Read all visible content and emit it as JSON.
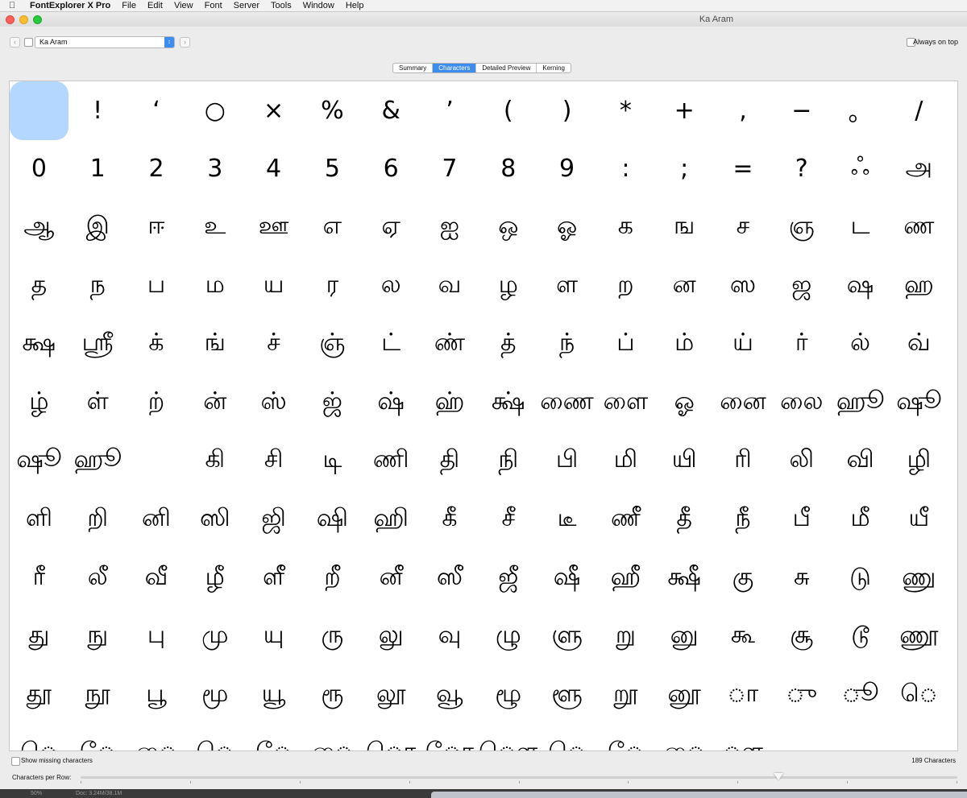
{
  "menubar": {
    "app_name": "FontExplorer X Pro",
    "items": [
      "File",
      "Edit",
      "View",
      "Font",
      "Server",
      "Tools",
      "Window",
      "Help"
    ]
  },
  "window": {
    "title": "Ka Aram"
  },
  "toolbar": {
    "font_select_value": "Ka Aram",
    "always_on_top_label": "Always on top"
  },
  "tabs": [
    {
      "label": "Summary",
      "active": false
    },
    {
      "label": "Characters",
      "active": true
    },
    {
      "label": "Detailed Preview",
      "active": false
    },
    {
      "label": "Kerning",
      "active": false
    }
  ],
  "glyphs": [
    "",
    "!",
    "‘",
    "○",
    "×",
    "%",
    "&",
    "’",
    "(",
    ")",
    "*",
    "+",
    ",",
    "−",
    "。",
    "/",
    "0",
    "1",
    "2",
    "3",
    "4",
    "5",
    "6",
    "7",
    "8",
    "9",
    ":",
    ";",
    "=",
    "?",
    "ஃ",
    "அ",
    "ஆ",
    "இ",
    "ஈ",
    "உ",
    "ஊ",
    "எ",
    "ஏ",
    "ஐ",
    "ஒ",
    "ஓ",
    "க",
    "ங",
    "ச",
    "ஞ",
    "ட",
    "ண",
    "த",
    "ந",
    "ப",
    "ம",
    "ய",
    "ர",
    "ல",
    "வ",
    "ழ",
    "ள",
    "ற",
    "ன",
    "ஸ",
    "ஜ",
    "ஷ",
    "ஹ",
    "க்ஷ",
    "ஸ்ரீ",
    "க்",
    "ங்",
    "ச்",
    "ஞ்",
    "ட்",
    "ண்",
    "த்",
    "ந்",
    "ப்",
    "ம்",
    "ய்",
    "ர்",
    "ல்",
    "வ்",
    "ழ்",
    "ள்",
    "ற்",
    "ன்",
    "ஸ்",
    "ஜ்",
    "ஷ்",
    "ஹ்",
    "க்ஷ்",
    "ணை",
    "ளை",
    "ஓ",
    "னை",
    "லை",
    "ஹூ",
    "ஷூ",
    "ஷூ",
    "ஹூ",
    "",
    "கி",
    "சி",
    "டி",
    "ணி",
    "தி",
    "நி",
    "பி",
    "மி",
    "யி",
    "ரி",
    "லி",
    "வி",
    "ழி",
    "ளி",
    "றி",
    "னி",
    "ஸி",
    "ஜி",
    "ஷி",
    "ஹி",
    "கீ",
    "சீ",
    "டீ",
    "ணீ",
    "தீ",
    "நீ",
    "பீ",
    "மீ",
    "யீ",
    "ரீ",
    "லீ",
    "வீ",
    "ழீ",
    "ளீ",
    "றீ",
    "னீ",
    "ஸீ",
    "ஜீ",
    "ஷீ",
    "ஹீ",
    "க்ஷீ",
    "கு",
    "சு",
    "டு",
    "ணு",
    "து",
    "நு",
    "பு",
    "மு",
    "யு",
    "ரு",
    "லு",
    "வு",
    "ழு",
    "ளு",
    "று",
    "னு",
    "கூ",
    "சூ",
    "டூ",
    "ணூ",
    "தூ",
    "நூ",
    "பூ",
    "மூ",
    "யூ",
    "ரூ",
    "லூ",
    "வூ",
    "ழூ",
    "ளூ",
    "றூ",
    "னூ",
    "ா",
    "ு",
    "ூ",
    "ெ",
    "ெ",
    "ே",
    "ை",
    "ெ",
    "ே",
    "ை",
    "ொ",
    "ோ",
    "ௌ",
    "ெ",
    "ே",
    "ை",
    "ௗ",
    "",
    "",
    ""
  ],
  "status": {
    "show_missing_label": "Show missing characters",
    "char_count": "189",
    "char_count_label": "Characters",
    "chars_per_row_label": "Characters per Row:",
    "chars_per_row_value": 16
  },
  "dock": {
    "zoom": "50%",
    "doc_info": "Doc: 3.24M/38.1M"
  }
}
